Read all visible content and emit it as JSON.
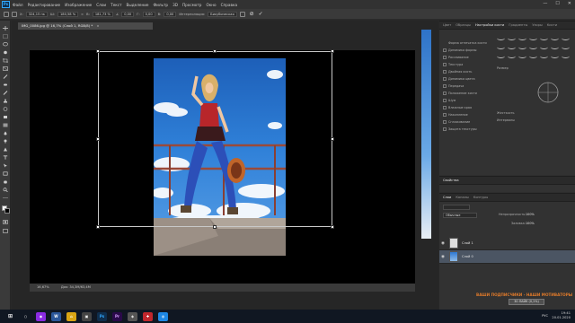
{
  "app": {
    "logo": "Ps"
  },
  "menu": [
    "Файл",
    "Редактирование",
    "Изображение",
    "Слои",
    "Текст",
    "Выделение",
    "Фильтр",
    "3D",
    "Просмотр",
    "Окно",
    "Справка"
  ],
  "window_controls": {
    "minimize": "—",
    "maximize": "☐",
    "close": "✕"
  },
  "options_bar": {
    "x": "324,15 пк",
    "w": "180,58 %",
    "h": "181,73 %",
    "angle": "0,00",
    "h_skew": "0,00",
    "v_skew": "0,00",
    "interpolation_label": "Интерполяция:",
    "interpolation_value": "Бикубическая",
    "cancel": "⊘",
    "commit": "✓"
  },
  "document": {
    "tab_title": "IMG_0086.jpg @ 16,7% (Слой 1, RGB/8) *",
    "close": "×",
    "zoom": "16,67%",
    "info": "Док: 34,3M/63,4M"
  },
  "panels": {
    "top_tabs": [
      "Цвет",
      "Образцы",
      "Настройки кисти",
      "Градиенты",
      "Узоры",
      "Кисти"
    ],
    "brush_settings": [
      "Форма отпечатка кисти",
      "Динамика формы",
      "Рассеивание",
      "Текстура",
      "Двойная кисть",
      "Динамика цвета",
      "Передача",
      "Положение кисти",
      "Шум",
      "Влажные края",
      "Накопление",
      "Сглаживание",
      "Защита текстуры"
    ],
    "brush_params": {
      "size_label": "Размер",
      "hardness_label": "Жесткость",
      "spacing_label": "Интервалы"
    },
    "properties_tab": "Свойства",
    "layers_tabs": [
      "Слои",
      "Каналы",
      "Контуры"
    ],
    "blend_mode": "Обычные",
    "opacity_label": "Непрозрачность:",
    "opacity_value": "100%",
    "fill_label": "Заливка:",
    "fill_value": "100%",
    "layers": [
      {
        "name": "Слой 1",
        "selected": false
      },
      {
        "name": "Слой 0",
        "selected": true
      }
    ]
  },
  "watermark": "ВАШИ ПОДПИСЧИКИ - НАШИ МОТИВАТОРЫ",
  "subscribe_badge": "30 ЛАЙК (0,1%)",
  "taskbar": {
    "apps": [
      "⊞",
      "○",
      "◉",
      "W",
      "⌂",
      "▣",
      "Ps",
      "Pr",
      "◈",
      "✚",
      "◍"
    ],
    "lang": "РУС",
    "time": "19:41",
    "date": "20.01.2020"
  }
}
